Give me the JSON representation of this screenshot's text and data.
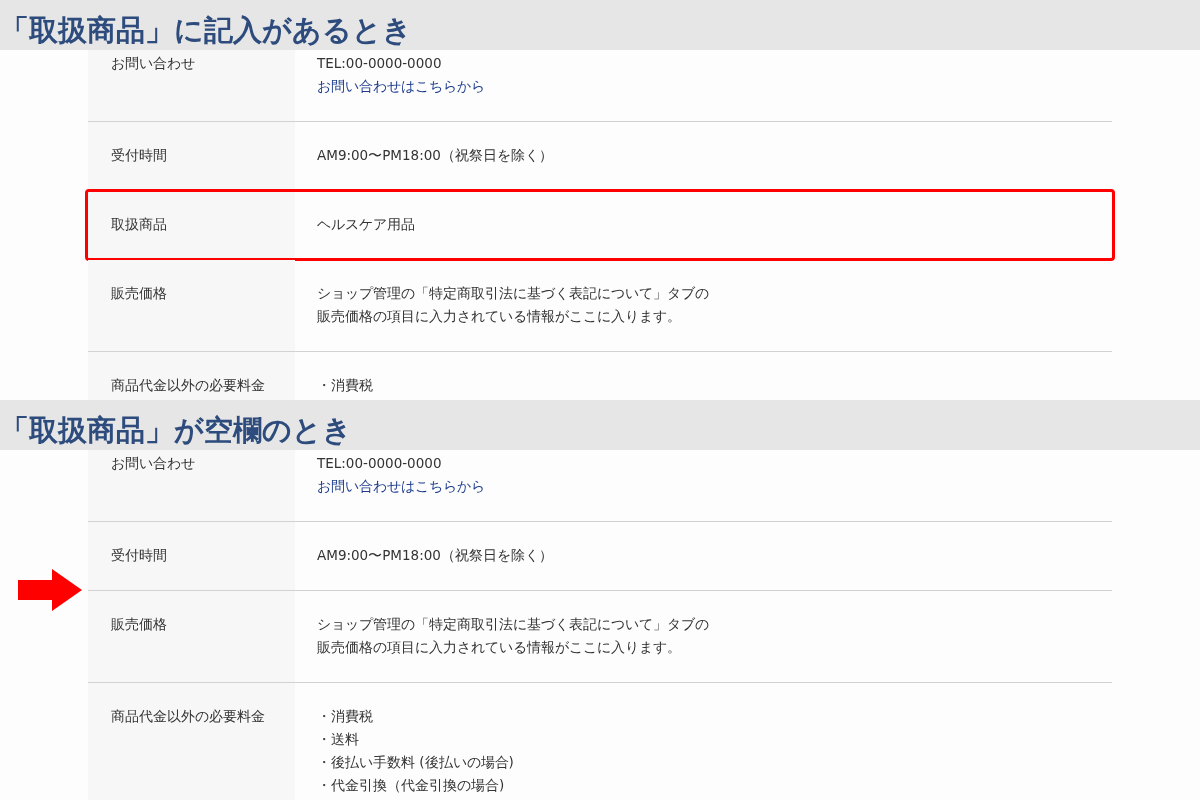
{
  "sections": [
    {
      "title": "「取扱商品」に記入があるとき",
      "rows": [
        {
          "label": "お問い合わせ",
          "lines": [
            {
              "kind": "text",
              "text": "TEL:00-0000-0000"
            },
            {
              "kind": "link",
              "text": "お問い合わせはこちらから"
            }
          ],
          "highlighted": false,
          "arrow": false
        },
        {
          "label": "受付時間",
          "lines": [
            {
              "kind": "text",
              "text": "AM9:00〜PM18:00（祝祭日を除く）"
            }
          ],
          "highlighted": false,
          "arrow": false
        },
        {
          "label": "取扱商品",
          "lines": [
            {
              "kind": "text",
              "text": "ヘルスケア用品"
            }
          ],
          "highlighted": true,
          "arrow": false
        },
        {
          "label": "販売価格",
          "lines": [
            {
              "kind": "text",
              "text": "ショップ管理の「特定商取引法に基づく表記について」タブの"
            },
            {
              "kind": "text",
              "text": "販売価格の項目に入力されている情報がここに入ります。"
            }
          ],
          "highlighted": false,
          "arrow": false
        },
        {
          "label": "商品代金以外の必要料金",
          "lines": [
            {
              "kind": "text",
              "text": "・消費税"
            }
          ],
          "highlighted": false,
          "arrow": false
        }
      ]
    },
    {
      "title": "「取扱商品」が空欄のとき",
      "rows": [
        {
          "label": "お問い合わせ",
          "lines": [
            {
              "kind": "text",
              "text": "TEL:00-0000-0000"
            },
            {
              "kind": "link",
              "text": "お問い合わせはこちらから"
            }
          ],
          "highlighted": false,
          "arrow": false
        },
        {
          "label": "受付時間",
          "lines": [
            {
              "kind": "text",
              "text": "AM9:00〜PM18:00（祝祭日を除く）"
            }
          ],
          "highlighted": false,
          "arrow": false
        },
        {
          "label": "販売価格",
          "lines": [
            {
              "kind": "text",
              "text": "ショップ管理の「特定商取引法に基づく表記について」タブの"
            },
            {
              "kind": "text",
              "text": "販売価格の項目に入力されている情報がここに入ります。"
            }
          ],
          "highlighted": false,
          "arrow": true
        },
        {
          "label": "商品代金以外の必要料金",
          "lines": [
            {
              "kind": "text",
              "text": "・消費税"
            },
            {
              "kind": "text",
              "text": "・送料"
            },
            {
              "kind": "text",
              "text": "・後払い手数料 (後払いの場合)"
            },
            {
              "kind": "text",
              "text": "・代金引換（代金引換の場合)"
            }
          ],
          "highlighted": false,
          "arrow": false
        }
      ]
    }
  ]
}
